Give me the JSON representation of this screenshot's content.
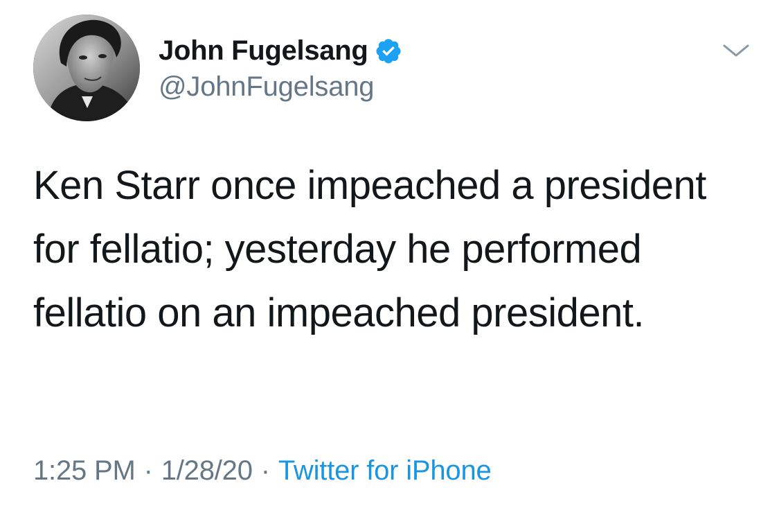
{
  "author": {
    "display_name": "John Fugelsang",
    "handle": "@JohnFugelsang",
    "verified": true,
    "avatar_icon": "profile-photo-grayscale"
  },
  "tweet": {
    "text": "Ken Starr once impeached a president for fellatio; yesterday he performed fellatio on an impeached president."
  },
  "meta": {
    "time": "1:25 PM",
    "separator": "·",
    "date": "1/28/20",
    "source": "Twitter for iPhone"
  },
  "colors": {
    "primary_text": "#14171a",
    "secondary_text": "#657786",
    "link": "#1b95e0",
    "verified_badge": "#1da1f2"
  },
  "icons": {
    "verified": "verified-badge-icon",
    "more": "chevron-down-icon"
  }
}
